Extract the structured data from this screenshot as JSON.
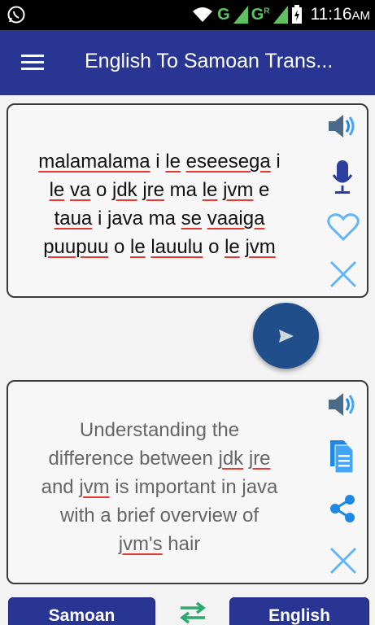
{
  "status_bar": {
    "time": "11:16",
    "ampm": "AM",
    "network_1": "G",
    "network_2": "G",
    "signal_r": "R",
    "icons": [
      "whatsapp-icon",
      "wifi-icon",
      "signal-icon",
      "battery-charging-icon"
    ]
  },
  "app_bar": {
    "title": "English To Samoan Trans..."
  },
  "source": {
    "lines": [
      [
        "malamalama",
        " i ",
        "le",
        " ",
        "eseesega",
        " i"
      ],
      [
        "le",
        " ",
        "va",
        " o ",
        "jdk",
        " ",
        "jre",
        " ma ",
        "le",
        " ",
        "jvm",
        " e"
      ],
      [
        "taua",
        " i java ma ",
        "se",
        " ",
        "vaaiga"
      ],
      [
        "puupuu",
        " o ",
        "le",
        " ",
        "lauulu",
        " o ",
        "le",
        " ",
        "jvm"
      ]
    ],
    "icons": [
      "speaker-icon",
      "microphone-icon",
      "heart-icon",
      "close-icon"
    ]
  },
  "translation": {
    "lines": [
      [
        "Understanding the"
      ],
      [
        "difference between ",
        "jdk",
        " ",
        "jre"
      ],
      [
        "and ",
        "jvm",
        " is important in java"
      ],
      [
        "with a brief overview of"
      ],
      [
        "jvm's",
        " hair"
      ]
    ],
    "icons": [
      "speaker-icon",
      "copy-icon",
      "share-icon",
      "close-icon"
    ]
  },
  "translate_button_icon": "send-icon",
  "buttons": {
    "from_language": "Samoan",
    "to_language": "English",
    "swap_icon": "swap-arrows-icon"
  },
  "colors": {
    "app_bar": "#283593",
    "fab": "#1f4e8a",
    "accent_icon": "#1565c0",
    "spell_underline": "#e53935",
    "swap": "#2eaa6e"
  }
}
